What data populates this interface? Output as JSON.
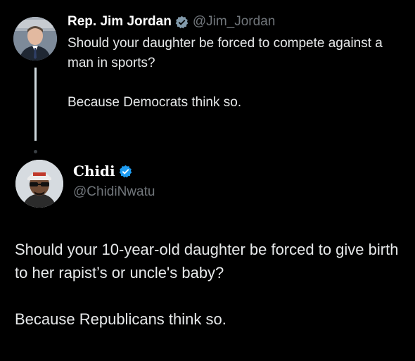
{
  "tweet1": {
    "name": "Rep. Jim Jordan",
    "handle": "@Jim_Jordan",
    "line1": "Should your daughter be forced to compete against a man in sports?",
    "line2": "Because Democrats think so."
  },
  "tweet2": {
    "name": "Chidi",
    "handle": "@ChidiNwatu",
    "line1": "Should your 10-year-old daughter be forced to give birth to her rapist’s or uncle's baby?",
    "line2": "Because Republicans think so."
  },
  "colors": {
    "background": "#000000",
    "text": "#e7e9ea",
    "muted": "#71767b",
    "verified_gov": "#829aab",
    "verified_blue": "#1d9bf0"
  }
}
